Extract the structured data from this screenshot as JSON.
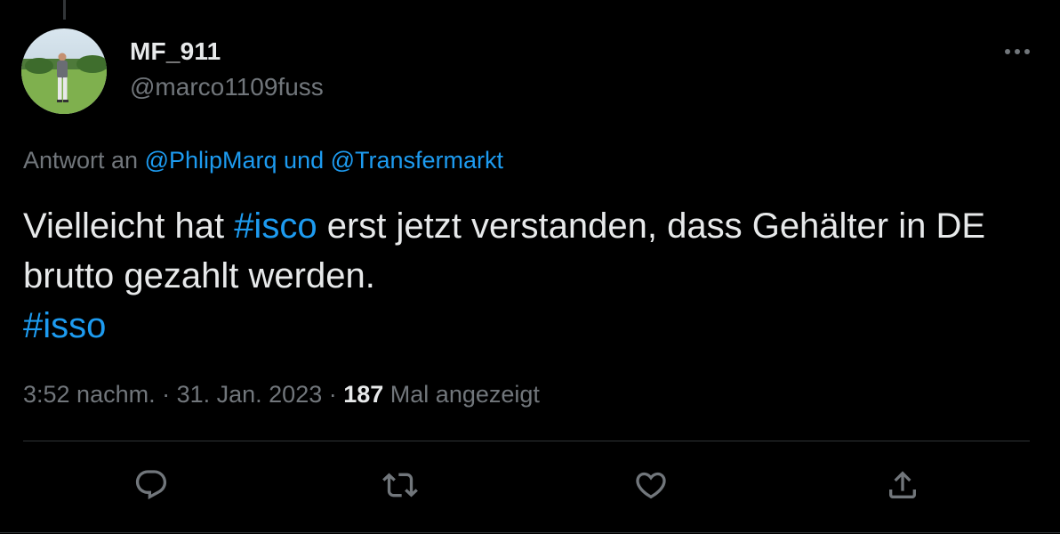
{
  "author": {
    "display_name": "MF_911",
    "handle": "@marco1109fuss"
  },
  "reply_to": {
    "prefix": "Antwort an ",
    "user1": "@PhlipMarq",
    "joiner": " und ",
    "user2": "@Transfermarkt"
  },
  "tweet": {
    "text_1": "Vielleicht hat ",
    "hashtag_1": "#isco",
    "text_2": " erst jetzt verstanden, dass Gehälter in DE brutto gezahlt werden.",
    "hashtag_2": "#isso"
  },
  "meta": {
    "time": "3:52 nachm.",
    "separator": " · ",
    "date": "31. Jan. 2023",
    "views_count": "187",
    "views_label": " Mal angezeigt"
  },
  "colors": {
    "background": "#000000",
    "text": "#e7e9ea",
    "secondary": "#71767b",
    "link": "#1d9bf0",
    "border": "#2f3336"
  },
  "icons": {
    "more": "more-horizontal-icon",
    "reply": "reply-bubble-icon",
    "retweet": "retweet-icon",
    "like": "heart-icon",
    "share": "share-upload-icon"
  }
}
